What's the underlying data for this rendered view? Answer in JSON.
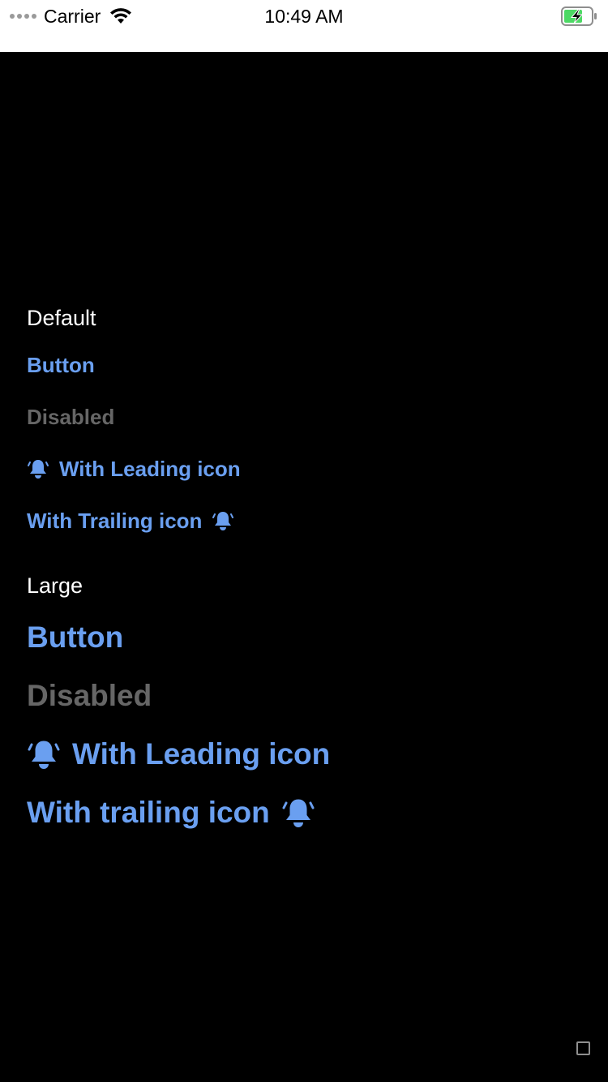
{
  "status_bar": {
    "carrier": "Carrier",
    "time": "10:49 AM",
    "icons": [
      "signal-dots-icon",
      "wifi-icon",
      "battery-charging-icon"
    ],
    "battery_color": "#4cd964"
  },
  "sections": {
    "default": {
      "title": "Default",
      "button_label": "Button",
      "disabled_label": "Disabled",
      "leading_icon_label": "With Leading icon",
      "trailing_icon_label": "With Trailing icon"
    },
    "large": {
      "title": "Large",
      "button_label": "Button",
      "disabled_label": "Disabled",
      "leading_icon_label": "With Leading icon",
      "trailing_icon_label": "With trailing icon"
    }
  },
  "colors": {
    "background": "#000000",
    "accent": "#6a9ff0",
    "disabled": "#666666",
    "title": "#ffffff"
  },
  "icons": {
    "button_icon": "bell-icon",
    "corner": "square-outline-icon"
  }
}
